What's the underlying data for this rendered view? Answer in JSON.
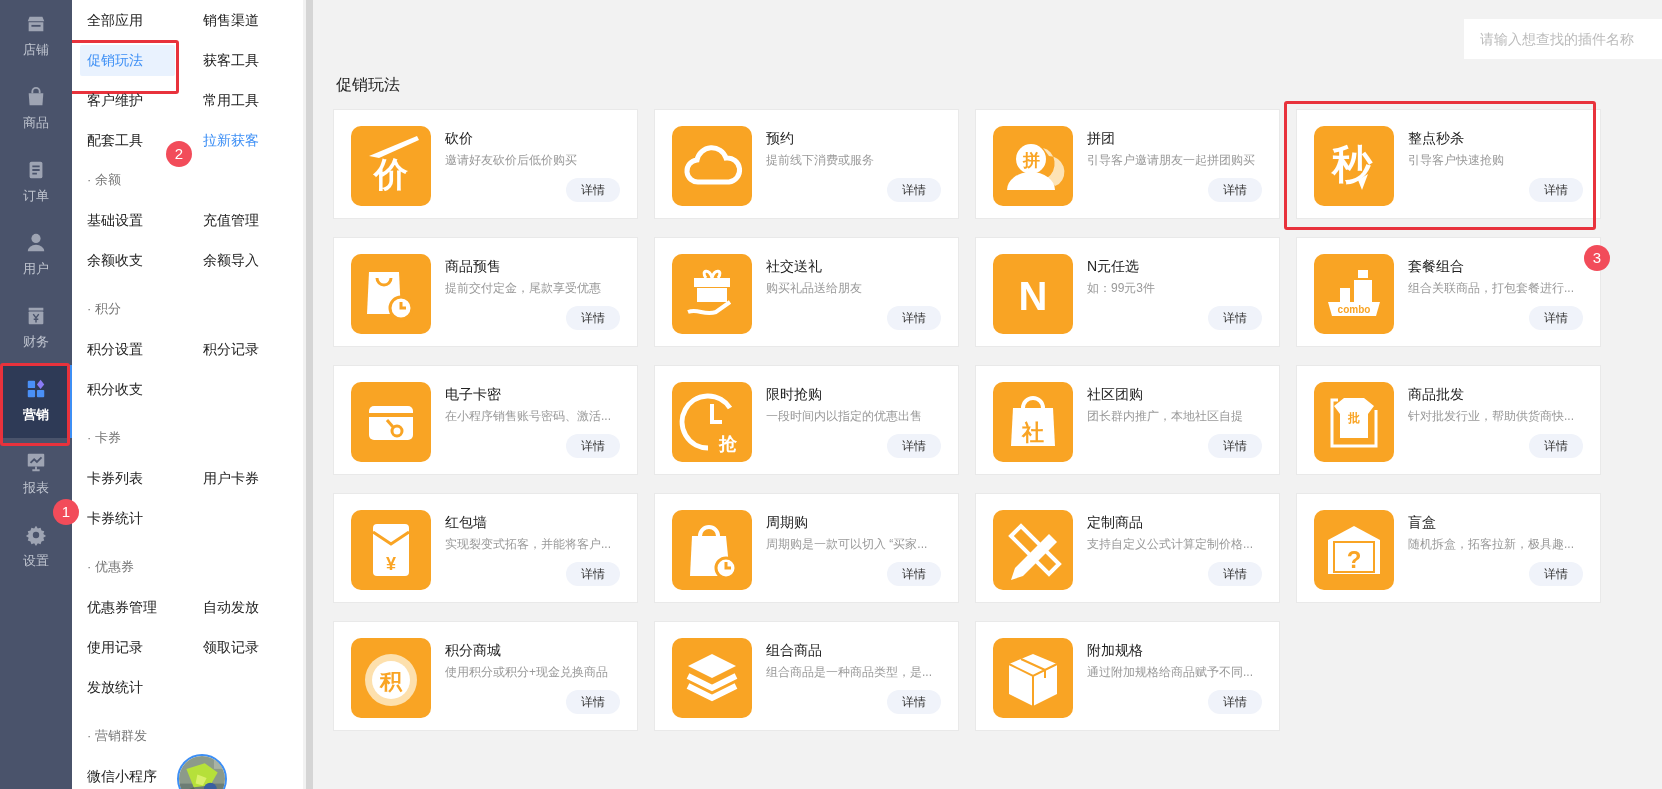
{
  "rail": [
    {
      "label": "店铺",
      "selected": false,
      "annotated": false
    },
    {
      "label": "商品",
      "selected": false,
      "annotated": false
    },
    {
      "label": "订单",
      "selected": false,
      "annotated": false
    },
    {
      "label": "用户",
      "selected": false,
      "annotated": false
    },
    {
      "label": "财务",
      "selected": false,
      "annotated": false
    },
    {
      "label": "营销",
      "selected": true,
      "annotated": true
    },
    {
      "label": "报表",
      "selected": false,
      "annotated": false
    },
    {
      "label": "设置",
      "selected": false,
      "annotated": false
    }
  ],
  "menu": {
    "sections": [
      {
        "items": [
          {
            "kind": "link",
            "label": "全部应用",
            "selected": false,
            "accent": false,
            "annotated": false
          },
          {
            "kind": "link",
            "label": "销售渠道",
            "selected": false,
            "accent": false,
            "annotated": false
          },
          {
            "kind": "link",
            "label": "促销玩法",
            "selected": true,
            "accent": false,
            "annotated": true
          },
          {
            "kind": "link",
            "label": "获客工具",
            "selected": false,
            "accent": false,
            "annotated": false
          },
          {
            "kind": "link",
            "label": "客户维护",
            "selected": false,
            "accent": false,
            "annotated": false
          },
          {
            "kind": "link",
            "label": "常用工具",
            "selected": false,
            "accent": false,
            "annotated": false
          },
          {
            "kind": "link",
            "label": "配套工具",
            "selected": false,
            "accent": false,
            "annotated": false
          },
          {
            "kind": "link",
            "label": "拉新获客",
            "selected": false,
            "accent": true,
            "annotated": false
          }
        ]
      },
      {
        "header": "· 余额",
        "items": [
          {
            "kind": "link",
            "label": "基础设置",
            "selected": false,
            "accent": false,
            "annotated": false
          },
          {
            "kind": "link",
            "label": "充值管理",
            "selected": false,
            "accent": false,
            "annotated": false
          },
          {
            "kind": "link",
            "label": "余额收支",
            "selected": false,
            "accent": false,
            "annotated": false
          },
          {
            "kind": "link",
            "label": "余额导入",
            "selected": false,
            "accent": false,
            "annotated": false
          }
        ]
      },
      {
        "header": "· 积分",
        "items": [
          {
            "kind": "link",
            "label": "积分设置",
            "selected": false,
            "accent": false,
            "annotated": false
          },
          {
            "kind": "link",
            "label": "积分记录",
            "selected": false,
            "accent": false,
            "annotated": false
          },
          {
            "kind": "link",
            "label": "积分收支",
            "selected": false,
            "accent": false,
            "annotated": false
          }
        ]
      },
      {
        "header": "· 卡券",
        "items": [
          {
            "kind": "link",
            "label": "卡券列表",
            "selected": false,
            "accent": false,
            "annotated": false
          },
          {
            "kind": "link",
            "label": "用户卡券",
            "selected": false,
            "accent": false,
            "annotated": false
          },
          {
            "kind": "link",
            "label": "卡券统计",
            "selected": false,
            "accent": false,
            "annotated": false
          }
        ]
      },
      {
        "header": "· 优惠券",
        "items": [
          {
            "kind": "link",
            "label": "优惠券管理",
            "selected": false,
            "accent": false,
            "annotated": false
          },
          {
            "kind": "link",
            "label": "自动发放",
            "selected": false,
            "accent": false,
            "annotated": false
          },
          {
            "kind": "link",
            "label": "使用记录",
            "selected": false,
            "accent": false,
            "annotated": false
          },
          {
            "kind": "link",
            "label": "领取记录",
            "selected": false,
            "accent": false,
            "annotated": false
          },
          {
            "kind": "link",
            "label": "发放统计",
            "selected": false,
            "accent": false,
            "annotated": false
          }
        ]
      },
      {
        "header": "· 营销群发",
        "items": [
          {
            "kind": "link",
            "label": "微信小程序",
            "selected": false,
            "accent": false,
            "annotated": false
          },
          {
            "kind": "picture"
          }
        ]
      }
    ]
  },
  "search": {
    "placeholder": "请输入想查找的插件名称"
  },
  "section_title": "促销玩法",
  "cards": [
    {
      "title": "砍价",
      "desc": "邀请好友砍价后低价购买",
      "glyph": "价",
      "button": "详情",
      "annotated": false
    },
    {
      "title": "预约",
      "desc": "提前线下消费或服务",
      "button": "详情",
      "annotated": false
    },
    {
      "title": "拼团",
      "desc": "引导客户邀请朋友一起拼团购买",
      "glyph": "拼",
      "button": "详情",
      "annotated": false
    },
    {
      "title": "整点秒杀",
      "desc": "引导客户快速抢购",
      "glyph": "秒",
      "button": "详情",
      "annotated": true
    },
    {
      "title": "商品预售",
      "desc": "提前交付定金，尾款享受优惠",
      "button": "详情",
      "annotated": false
    },
    {
      "title": "社交送礼",
      "desc": "购买礼品送给朋友",
      "button": "详情",
      "annotated": false
    },
    {
      "title": "N元任选",
      "desc": "如：99元3件",
      "glyph": "N",
      "button": "详情",
      "annotated": false
    },
    {
      "title": "套餐组合",
      "desc": "组合关联商品，打包套餐进行...",
      "glyph": "combo",
      "button": "详情",
      "annotated": false
    },
    {
      "title": "电子卡密",
      "desc": "在小程序销售账号密码、激活...",
      "button": "详情",
      "annotated": false
    },
    {
      "title": "限时抢购",
      "desc": "一段时间内以指定的优惠出售",
      "glyph": "抢",
      "button": "详情",
      "annotated": false
    },
    {
      "title": "社区团购",
      "desc": "团长群内推广，本地社区自提",
      "glyph": "社",
      "button": "详情",
      "annotated": false
    },
    {
      "title": "商品批发",
      "desc": "针对批发行业，帮助供货商快...",
      "glyph": "批",
      "button": "详情",
      "annotated": false
    },
    {
      "title": "红包墙",
      "desc": "实现裂变式拓客，并能将客户...",
      "glyph": "¥",
      "button": "详情",
      "annotated": false
    },
    {
      "title": "周期购",
      "desc": "周期购是一款可以切入 “买家...",
      "button": "详情",
      "annotated": false
    },
    {
      "title": "定制商品",
      "desc": "支持自定义公式计算定制价格...",
      "button": "详情",
      "annotated": false
    },
    {
      "title": "盲盒",
      "desc": "随机拆盒，拓客拉新，极具趣...",
      "glyph": "?",
      "button": "详情",
      "annotated": false
    },
    {
      "title": "积分商城",
      "desc": "使用积分或积分+现金兑换商品",
      "glyph": "积",
      "button": "详情",
      "annotated": false
    },
    {
      "title": "组合商品",
      "desc": "组合商品是一种商品类型，是...",
      "button": "详情",
      "annotated": false
    },
    {
      "title": "附加规格",
      "desc": "通过附加规格给商品赋予不同...",
      "button": "详情",
      "annotated": false
    }
  ],
  "markers": [
    {
      "label": "1"
    },
    {
      "label": "2"
    },
    {
      "label": "3"
    }
  ]
}
